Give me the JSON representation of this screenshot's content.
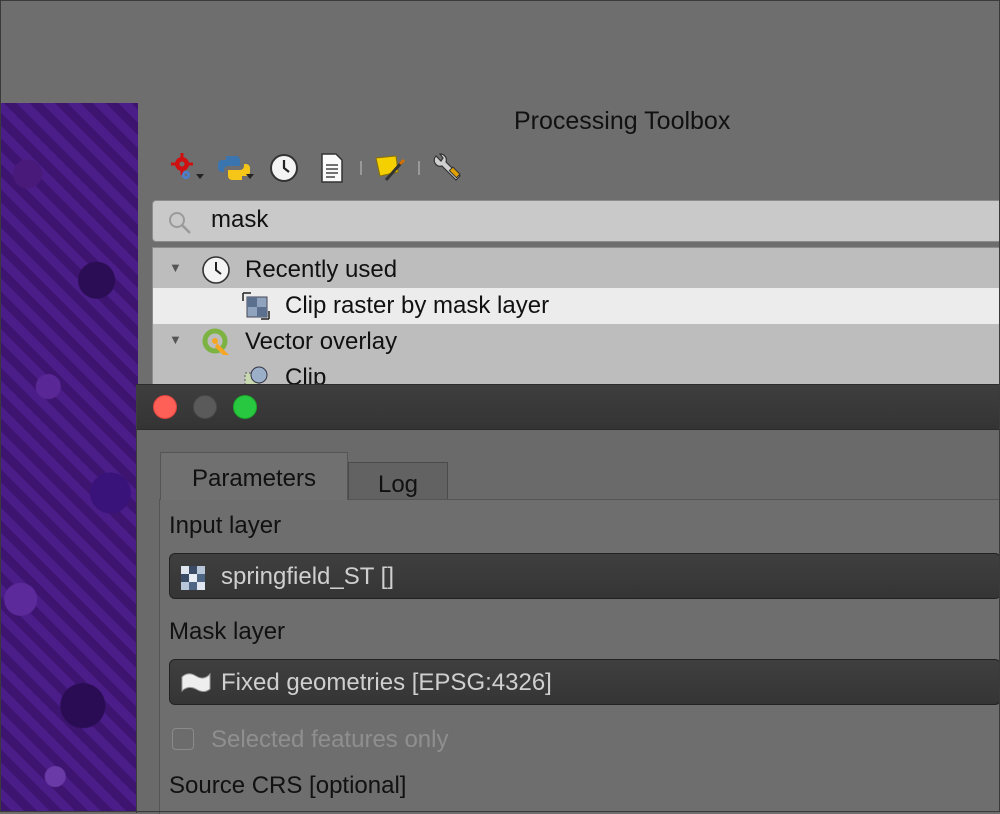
{
  "toolbox": {
    "title": "Processing Toolbox",
    "search_value": "mask",
    "tree": {
      "group_recent": "Recently used",
      "item_clip_raster": "Clip raster by mask layer",
      "group_vector_overlay": "Vector overlay",
      "item_clip": "Clip"
    },
    "toolbar_icons": [
      "models-gear-icon",
      "python-icon",
      "history-icon",
      "results-viewer-icon",
      "edit-features-icon",
      "options-wrench-icon"
    ]
  },
  "dialog": {
    "tabs": {
      "parameters": "Parameters",
      "log": "Log"
    },
    "input_layer_label": "Input layer",
    "input_layer_value": "springfield_ST []",
    "mask_layer_label": "Mask layer",
    "mask_layer_value": "Fixed geometries [EPSG:4326]",
    "selected_features_label": "Selected features only",
    "source_crs_label": "Source CRS [optional]"
  },
  "colors": {
    "close_button": "#fe5f57",
    "maximize_button": "#28c940",
    "selected_row": "#ececec"
  }
}
